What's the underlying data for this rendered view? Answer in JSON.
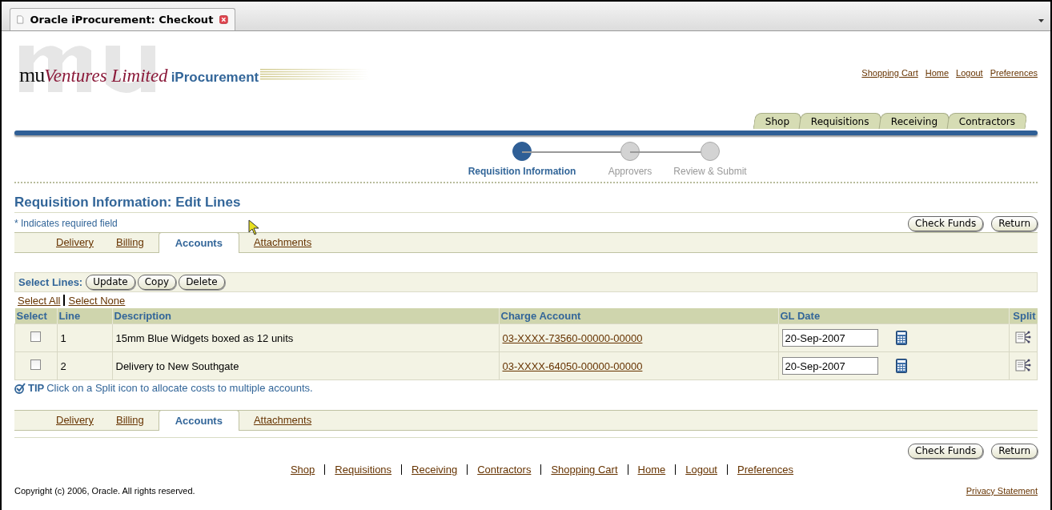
{
  "browser_tab": {
    "title": "Oracle iProcurement: Checkout"
  },
  "logo": {
    "mark": "mu",
    "company": "Ventures Limited",
    "product": "iProcurement"
  },
  "global_links": [
    "Shopping Cart",
    "Home",
    "Logout",
    "Preferences"
  ],
  "tabs": [
    {
      "label": "Shop",
      "selected": false
    },
    {
      "label": "Requisitions",
      "selected": false
    },
    {
      "label": "Receiving",
      "selected": false
    },
    {
      "label": "Contractors",
      "selected": false
    }
  ],
  "train": [
    {
      "label": "Requisition Information",
      "selected": true
    },
    {
      "label": "Approvers",
      "selected": false
    },
    {
      "label": "Review & Submit",
      "selected": false
    }
  ],
  "page_title": "Requisition Information: Edit Lines",
  "required_note": {
    "mark": "*",
    "text": "Indicates required field"
  },
  "action_buttons": [
    "Check Funds",
    "Return"
  ],
  "subtabs": [
    {
      "label": "Delivery",
      "selected": false
    },
    {
      "label": "Billing",
      "selected": false
    },
    {
      "label": "Accounts",
      "selected": true
    },
    {
      "label": "Attachments",
      "selected": false
    }
  ],
  "select_lines": {
    "label": "Select Lines:",
    "buttons": [
      "Update",
      "Copy",
      "Delete"
    ],
    "links": [
      "Select All",
      "Select None"
    ]
  },
  "table": {
    "columns": [
      "Select",
      "Line",
      "Description",
      "Charge Account",
      "GL Date",
      "Split"
    ],
    "rows": [
      {
        "checked": false,
        "line": "1",
        "description": "15mm Blue Widgets boxed as 12 units",
        "charge_account": "03-XXXX-73560-00000-00000",
        "gl_date": "20-Sep-2007"
      },
      {
        "checked": false,
        "line": "2",
        "description": "Delivery to New Southgate",
        "charge_account": "03-XXXX-64050-00000-00000",
        "gl_date": "20-Sep-2007"
      }
    ]
  },
  "tip": {
    "label": "TIP",
    "text": "Click on a Split icon to allocate costs to multiple accounts."
  },
  "subtabs_bottom": [
    {
      "label": "Delivery",
      "selected": false
    },
    {
      "label": "Billing",
      "selected": false
    },
    {
      "label": "Accounts",
      "selected": true
    },
    {
      "label": "Attachments",
      "selected": false
    }
  ],
  "action_buttons_bottom": [
    "Check Funds",
    "Return"
  ],
  "footer": {
    "links": [
      "Shop",
      "Requisitions",
      "Receiving",
      "Contractors",
      "Shopping Cart",
      "Home",
      "Logout",
      "Preferences"
    ],
    "copyright": "Copyright (c) 2006, Oracle. All rights reserved.",
    "privacy": "Privacy Statement"
  }
}
